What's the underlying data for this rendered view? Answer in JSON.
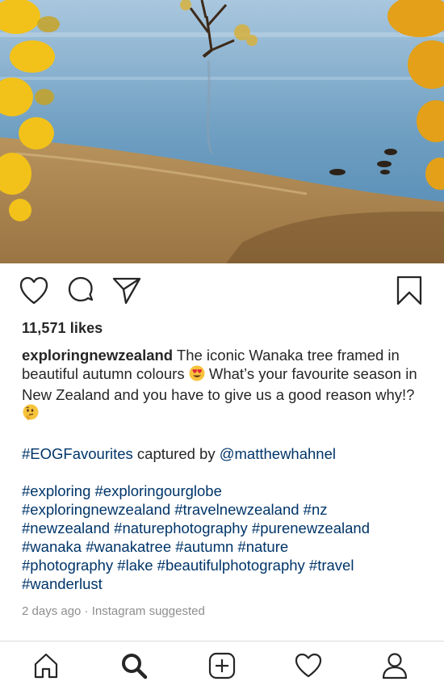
{
  "post": {
    "likes": "11,571 likes",
    "username": "exploringnewzealand",
    "caption_part1": " The iconic Wanaka tree framed in beautiful autumn colours ",
    "caption_part2": " What’s your favourite season in New Zealand and you have to give us a good reason why!? ",
    "emoji_heart_eyes": "heart-eyes-emoji",
    "emoji_thinking": "thinking-emoji",
    "credit_tag": "#EOGFavourites",
    "credit_text": " captured by ",
    "credit_user": "@matthewhahnel",
    "hashtags": [
      "#exploring",
      "#exploringourglobe",
      "#exploringnewzealand",
      "#travelnewzealand",
      "#nz",
      "#newzealand",
      "#naturephotography",
      "#purenewzealand",
      "#wanaka",
      "#wanakatree",
      "#autumn",
      "#nature",
      "#photography",
      "#lake",
      "#beautifulphotography",
      "#travel",
      "#wanderlust"
    ],
    "meta": "2 days ago · Instagram suggested"
  },
  "actions": {
    "icons": [
      "heart-icon",
      "comment-icon",
      "share-icon",
      "bookmark-icon"
    ]
  },
  "tabbar": {
    "icons": [
      "home-icon",
      "search-icon",
      "add-post-icon",
      "activity-heart-icon",
      "profile-icon"
    ]
  },
  "colors": {
    "text": "#262626",
    "hashtag": "#003569",
    "meta": "#8e8e8e",
    "divider": "#dbdbdb"
  }
}
